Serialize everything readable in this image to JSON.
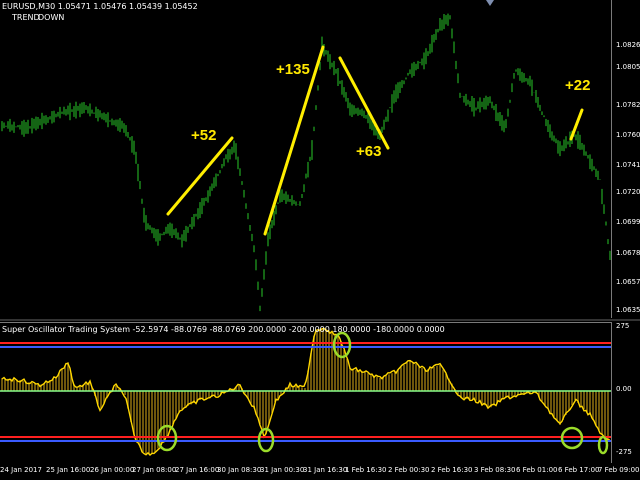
{
  "symbol_info": "EURUSD,M30  1.05471 1.05476 1.05439 1.05452",
  "trend_label": "TREND",
  "trend_value": "DOWN",
  "indicator_info": "Super Oscillator Trading System -52.5974 -88.0769 -88.0769 200.0000 -200.0000 180.0000 -180.0000 0.0000",
  "annotations": [
    "+52",
    "+135",
    "+63",
    "+22"
  ],
  "price_axis": [
    "1.08265",
    "1.08050",
    "1.07820",
    "1.07605",
    "1.07415",
    "1.07205",
    "1.06990",
    "1.06785",
    "1.06575",
    "1.06355"
  ],
  "osc_axis": [
    "275",
    "0.00",
    "-275"
  ],
  "time_axis": [
    "24 Jan 2017",
    "25 Jan 16:00",
    "26 Jan 00:00",
    "27 Jan 08:00",
    "27 Jan 16:00",
    "30 Jan 08:30",
    "31 Jan 00:30",
    "31 Jan 16:30",
    "1 Feb 16:30",
    "2 Feb 00:30",
    "2 Feb 16:30",
    "3 Feb 08:30",
    "6 Feb 01:00",
    "6 Feb 17:00",
    "7 Feb 09:00"
  ],
  "colors": {
    "candles": "#1f9a1f",
    "osc": "#ffd700",
    "level_red": "#ff2020",
    "level_blue": "#3a5bff",
    "zero_line": "#8aff8a",
    "marker": "#9bdc2a"
  }
}
